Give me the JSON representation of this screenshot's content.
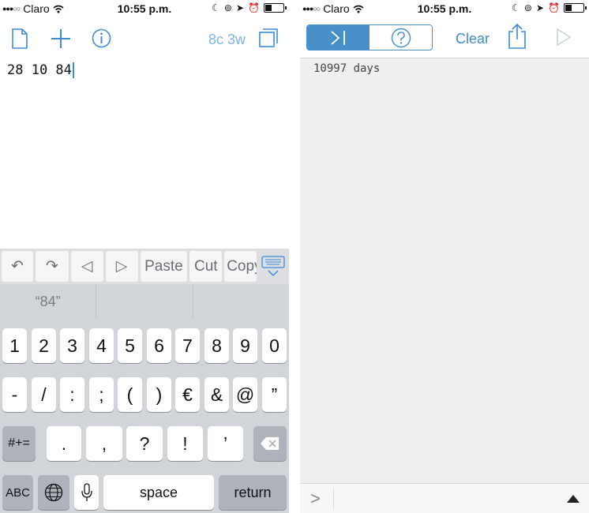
{
  "status": {
    "carrier": "Claro",
    "signal_dots": "●●●○○",
    "time": "10:55 p.m."
  },
  "editor": {
    "toolbar": {
      "counter": "8c 3w"
    },
    "text": "28 10 84"
  },
  "accessory": {
    "undo": "↶",
    "redo": "↷",
    "left": "◁",
    "right": "▷",
    "paste": "Paste",
    "cut": "Cut",
    "copy": "Copy"
  },
  "suggestions": [
    "“84”",
    "",
    ""
  ],
  "keyboard": {
    "row1": [
      "1",
      "2",
      "3",
      "4",
      "5",
      "6",
      "7",
      "8",
      "9",
      "0"
    ],
    "row2": [
      "-",
      "/",
      ":",
      ";",
      "(",
      ")",
      "€",
      "&",
      "@",
      "”"
    ],
    "row3": [
      ".",
      ",",
      "?",
      "!",
      "’"
    ],
    "symbols_key": "#+=",
    "abc_key": "ABC",
    "space": "space",
    "return": "return"
  },
  "console": {
    "clear_label": "Clear",
    "output": "10997 days",
    "prompt": ">"
  },
  "colors": {
    "accent": "#3d8bd9",
    "segment_active": "#4a90c8",
    "keyboard_bg": "#d1d4d8"
  }
}
